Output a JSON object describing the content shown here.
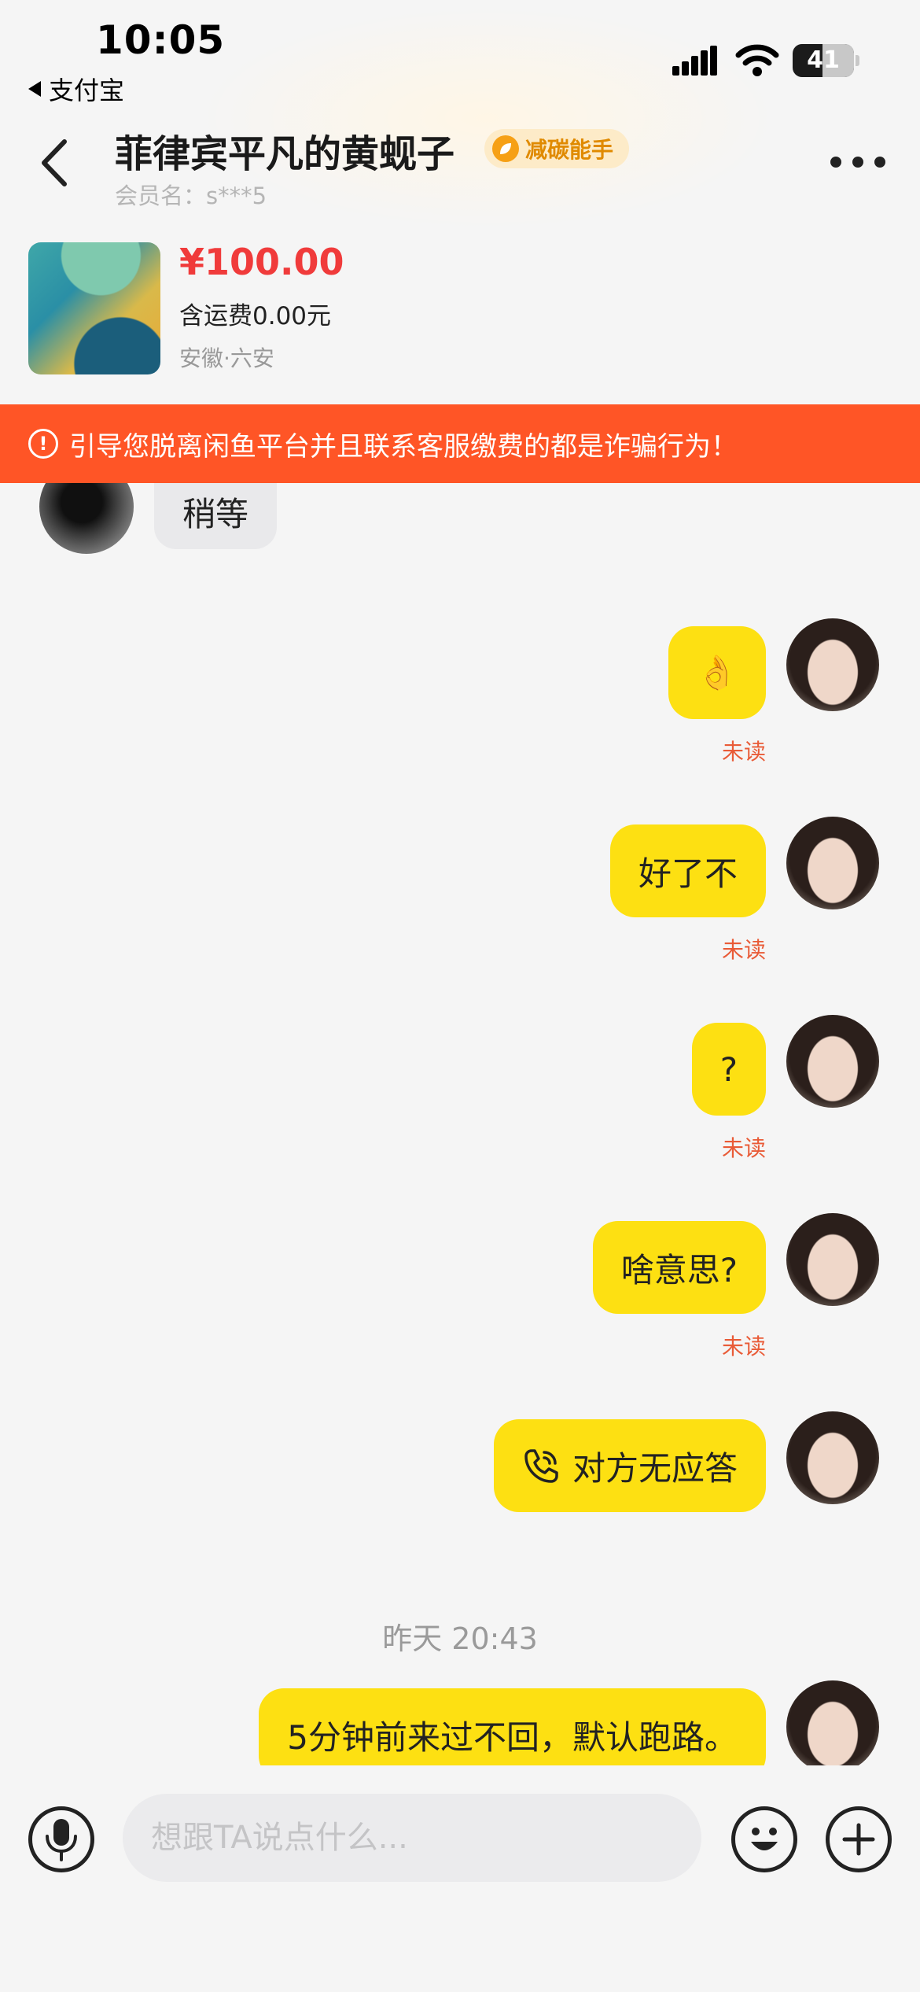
{
  "status_bar": {
    "time": "10:05",
    "back_app": "支付宝",
    "battery": "41"
  },
  "header": {
    "title": "菲律宾平凡的黄蚬子",
    "badge": "减碳能手",
    "member": "会员名：s***5"
  },
  "product": {
    "price": "¥100.00",
    "shipping": "含运费0.00元",
    "location": "安徽·六安"
  },
  "warning": {
    "text": "引导您脱离闲鱼平台并且联系客服缴费的都是诈骗行为！"
  },
  "messages": [
    {
      "side": "left",
      "text": "稍等"
    },
    {
      "side": "right",
      "text": "👌",
      "status": "未读"
    },
    {
      "side": "right",
      "text": "好了不",
      "status": "未读"
    },
    {
      "side": "right",
      "text": "?",
      "status": "未读"
    },
    {
      "side": "right",
      "text": "啥意思?",
      "status": "未读"
    },
    {
      "side": "right",
      "text": "对方无应答",
      "icon": "phone-call-icon"
    },
    {
      "side": "center",
      "text": "昨天 20:43"
    },
    {
      "side": "right",
      "text": "5分钟前来过不回，默认跑路。"
    }
  ],
  "input": {
    "placeholder": "想跟TA说点什么..."
  },
  "colors": {
    "bubble_self": "#fde012",
    "warning_bg": "#ff5526",
    "price": "#f03b3b",
    "unread": "#e95b37"
  }
}
